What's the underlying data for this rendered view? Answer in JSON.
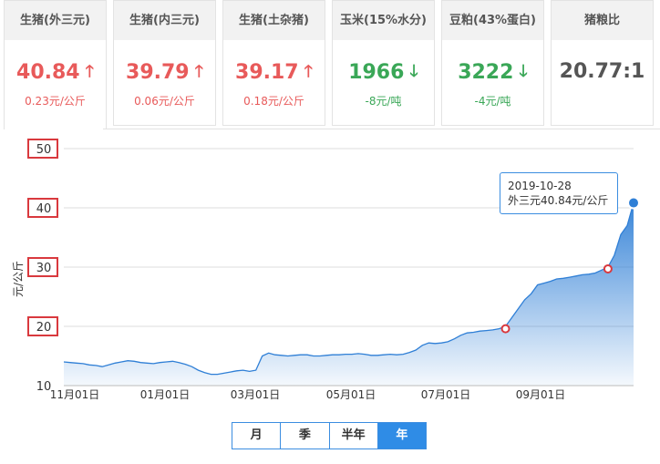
{
  "cards": [
    {
      "title": "生猪(外三元)",
      "value": "40.84",
      "arrow": "up",
      "change": "0.23元/公斤"
    },
    {
      "title": "生猪(内三元)",
      "value": "39.79",
      "arrow": "up",
      "change": "0.06元/公斤"
    },
    {
      "title": "生猪(土杂猪)",
      "value": "39.17",
      "arrow": "up",
      "change": "0.18元/公斤"
    },
    {
      "title": "玉米(15%水分)",
      "value": "1966",
      "arrow": "down",
      "change": "-8元/吨"
    },
    {
      "title": "豆粕(43%蛋白)",
      "value": "3222",
      "arrow": "down",
      "change": "-4元/吨"
    },
    {
      "title": "猪粮比",
      "value": "20.77:1",
      "arrow": "none",
      "change": ""
    }
  ],
  "range_tabs": [
    "月",
    "季",
    "半年",
    "年"
  ],
  "active_tab": "年",
  "tooltip": {
    "date": "2019-10-28",
    "text": "外三元40.84元/公斤"
  },
  "colors": {
    "up": "#e85a5a",
    "down": "#3aa757",
    "line": "#2f7fd6",
    "highlight": "#d9393e"
  },
  "chart_data": {
    "type": "area",
    "ylabel": "元/公斤",
    "ylim": [
      10,
      50
    ],
    "yticks": [
      10,
      20,
      30,
      40,
      50
    ],
    "highlighted_yticks": [
      20,
      30,
      40,
      50
    ],
    "xticks": [
      "11月01日",
      "01月01日",
      "03月01日",
      "05月01日",
      "07月01日",
      "09月01日"
    ],
    "grid": true,
    "series": [
      {
        "values": [
          14,
          13.9,
          13.8,
          13.7,
          13.5,
          13.4,
          13.2,
          13.5,
          13.8,
          14,
          14.2,
          14.1,
          13.9,
          13.8,
          13.7,
          13.9,
          14,
          14.1,
          13.9,
          13.6,
          13.2,
          12.6,
          12.2,
          11.9,
          11.9,
          12.1,
          12.3,
          12.5,
          12.6,
          12.4,
          12.6,
          15,
          15.5,
          15.2,
          15.1,
          15,
          15.1,
          15.2,
          15.2,
          15,
          15,
          15.1,
          15.2,
          15.2,
          15.3,
          15.3,
          15.4,
          15.3,
          15.1,
          15.1,
          15.2,
          15.3,
          15.2,
          15.3,
          15.6,
          16,
          16.8,
          17.2,
          17.1,
          17.2,
          17.4,
          17.9,
          18.5,
          18.9,
          19,
          19.2,
          19.3,
          19.4,
          19.6,
          20,
          21.5,
          23,
          24.5,
          25.5,
          27,
          27.3,
          27.6,
          28,
          28.1,
          28.3,
          28.5,
          28.7,
          28.8,
          29,
          29.5,
          30,
          32,
          35.5,
          37,
          40.84
        ]
      }
    ],
    "markers": [
      {
        "label": "x1",
        "index": 69,
        "value": 19.6
      },
      {
        "label": "x2",
        "index": 85,
        "value": 29.7
      }
    ],
    "last_point": {
      "date": "2019-10-28",
      "value": 40.84
    }
  }
}
